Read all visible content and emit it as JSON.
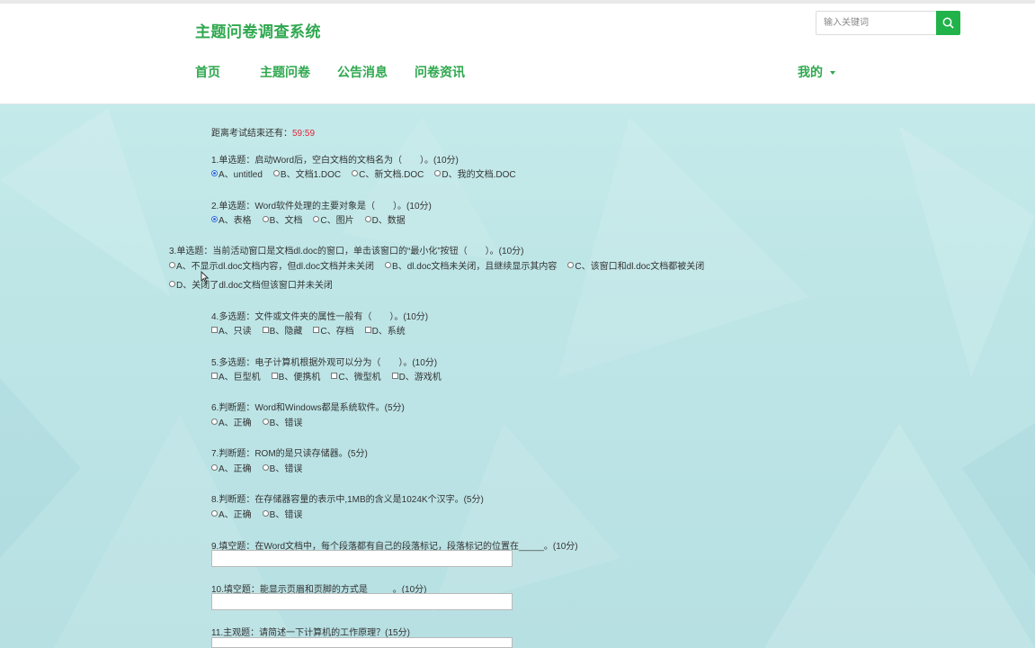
{
  "header": {
    "site_title": "主题问卷调查系统",
    "search_placeholder": "输入关键词",
    "nav": [
      "首页",
      "主题问卷",
      "公告消息",
      "问卷资讯"
    ],
    "mine": "我的"
  },
  "timer": {
    "label": "距离考试结束还有：",
    "value": "59:59"
  },
  "questions": {
    "q1": {
      "text": "1.单选题：启动Word后，空白文档的文档名为（　　）。(10分)",
      "options": [
        "A、untitled",
        "B、文档1.DOC",
        "C、新文档.DOC",
        "D、我的文档.DOC"
      ],
      "selected": "A"
    },
    "q2": {
      "text": "2.单选题：Word软件处理的主要对象是（　　）。(10分)",
      "options": [
        "A、表格",
        "B、文档",
        "C、图片",
        "D、数据"
      ],
      "selected": "A"
    },
    "q3": {
      "text": "3.单选题：当前活动窗口是文档dl.doc的窗口，单击该窗口的“最小化”按钮（　　）。(10分)",
      "options": [
        "A、不显示dl.doc文档内容，但dl.doc文档并未关闭",
        "B、dl.doc文档未关闭，且继续显示其内容",
        "C、该窗口和dl.doc文档都被关闭",
        "D、关闭了dl.doc文档但该窗口并未关闭"
      ]
    },
    "q4": {
      "text": "4.多选题：文件或文件夹的属性一般有（　　）。(10分)",
      "options": [
        "A、只读",
        "B、隐藏",
        "C、存档",
        "D、系统"
      ]
    },
    "q5": {
      "text": "5.多选题：电子计算机根据外观可以分为（　　）。(10分)",
      "options": [
        "A、巨型机",
        "B、便携机",
        "C、微型机",
        "D、游戏机"
      ]
    },
    "q6": {
      "text": "6.判断题：Word和Windows都是系统软件。(5分)",
      "options": [
        "A、正确",
        "B、错误"
      ]
    },
    "q7": {
      "text": "7.判断题：ROM的是只读存储器。(5分)",
      "options": [
        "A、正确",
        "B、错误"
      ]
    },
    "q8": {
      "text": "8.判断题：在存储器容量的表示中,1MB的含义是1024K个汉字。(5分)",
      "options": [
        "A、正确",
        "B、错误"
      ]
    },
    "q9": {
      "text": "9.填空题：在Word文档中，每个段落都有自己的段落标记，段落标记的位置在_____。(10分)"
    },
    "q10": {
      "text": "10.填空题：能显示页眉和页脚的方式是_____。(10分)"
    },
    "q11": {
      "text": "11.主观题：请简述一下计算机的工作原理？(15分)"
    }
  },
  "colors": {
    "accent": "#2fa84f",
    "search_button": "#21b34a",
    "timer": "#e0283a",
    "selected_radio": "#2b6fd6"
  }
}
